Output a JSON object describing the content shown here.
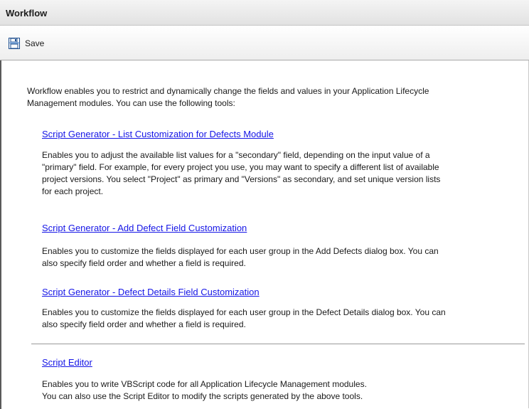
{
  "window": {
    "title": "Workflow"
  },
  "toolbar": {
    "save_label": "Save",
    "save_icon": "save-icon"
  },
  "intro": {
    "line1": "Workflow enables you to restrict and dynamically change the fields and values in your Application Lifecycle",
    "line2": "Management modules. You can use the following tools:"
  },
  "tools": [
    {
      "link": "Script Generator - List Customization for Defects Module",
      "desc": [
        "Enables you to adjust the available list values for a \"secondary\" field, depending on the input value of a",
        "\"primary\" field. For example, for every project you use, you may want to specify a different list of available",
        "project versions. You select \"Project\" as primary and \"Versions\" as secondary, and set unique version lists",
        "for each project."
      ]
    },
    {
      "link": "Script Generator - Add Defect Field Customization",
      "desc": [
        "Enables you to customize the fields displayed for each user group in the Add Defects dialog box. You can",
        "also specify field order and whether a field is required."
      ]
    },
    {
      "link": "Script Generator - Defect Details Field Customization",
      "desc": [
        "Enables you to customize the fields displayed for each user group in the Defect Details dialog box. You can",
        "also specify field order and whether a field is required."
      ]
    },
    {
      "link": "Script Editor",
      "desc": [
        "Enables you to write VBScript code for all Application Lifecycle Management modules.",
        "You can also use the Script Editor to modify the scripts generated by the above tools."
      ]
    }
  ]
}
